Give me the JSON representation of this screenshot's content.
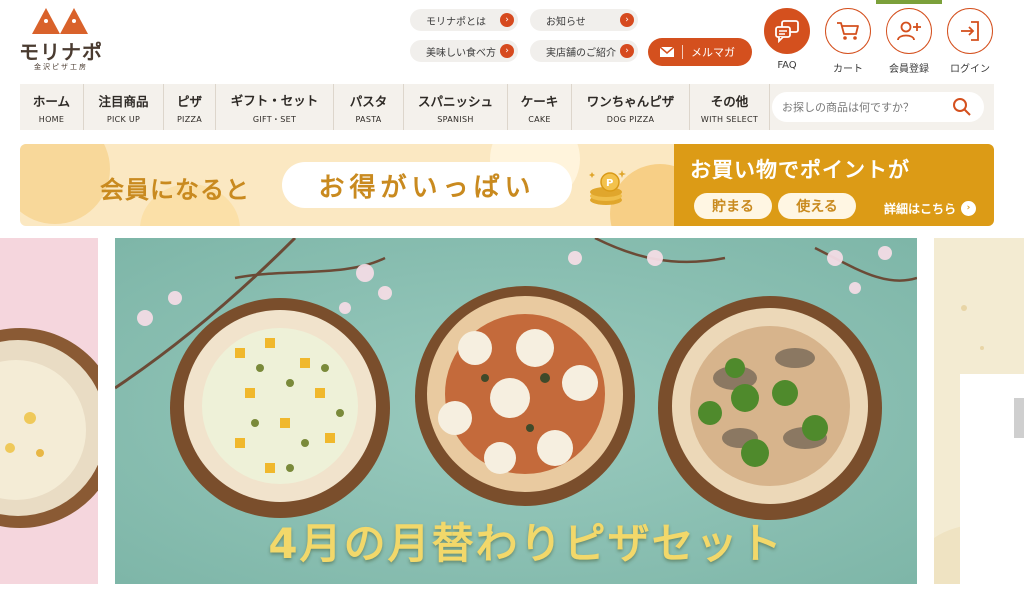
{
  "logo": {
    "name": "モリナポ",
    "sub": "金沢ピザ工房"
  },
  "header_links": [
    {
      "label": "モリナポとは"
    },
    {
      "label": "お知らせ"
    },
    {
      "label": "美味しい食べ方"
    },
    {
      "label": "実店舗のご紹介"
    }
  ],
  "mailmag": {
    "label": "メルマガ"
  },
  "header_icons": [
    {
      "label": "FAQ",
      "icon": "faq-chat-icon"
    },
    {
      "label": "カート",
      "icon": "cart-icon"
    },
    {
      "label": "会員登録",
      "icon": "add-user-icon"
    },
    {
      "label": "ログイン",
      "icon": "login-icon"
    }
  ],
  "nav": [
    {
      "ja": "ホーム",
      "en": "HOME"
    },
    {
      "ja": "注目商品",
      "en": "PICK UP"
    },
    {
      "ja": "ピザ",
      "en": "PIZZA"
    },
    {
      "ja": "ギフト・セット",
      "en": "GIFT・SET"
    },
    {
      "ja": "パスタ",
      "en": "PASTA"
    },
    {
      "ja": "スパニッシュ",
      "en": "SPANISH"
    },
    {
      "ja": "ケーキ",
      "en": "CAKE"
    },
    {
      "ja": "ワンちゃんピザ",
      "en": "DOG PIZZA"
    },
    {
      "ja": "その他",
      "en": "WITH SELECT"
    }
  ],
  "search": {
    "placeholder": "お探しの商品は何ですか？"
  },
  "banner": {
    "left": "会員になると",
    "pill": "お得がいっぱい",
    "right_title": "お買い物でポイントが",
    "pill1": "貯まる",
    "pill2": "使える",
    "more": "詳細はこちら"
  },
  "hero": {
    "title": "4月の月替わりピザセット"
  },
  "colors": {
    "accent": "#d4501e",
    "nav_bg": "#f4f1ec",
    "banner_gold": "#dc9b16",
    "hero_bg": "#8fc4b7"
  }
}
